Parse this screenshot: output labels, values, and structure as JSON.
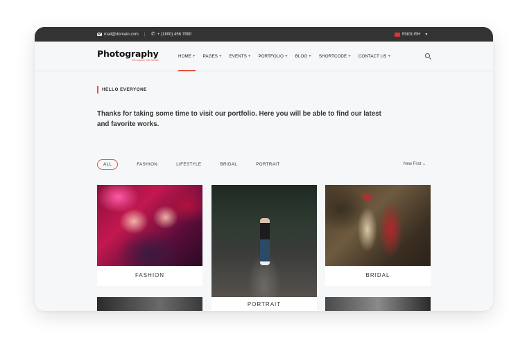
{
  "topbar": {
    "email": "mail@domain.com",
    "separator": "|",
    "phone": "+ (1800) 456 7890",
    "language": "ENGLISH"
  },
  "header": {
    "logo_title": "Photography",
    "logo_tagline": "We Capture Your Smiles",
    "nav": [
      {
        "label": "HOME",
        "suffix": "+",
        "active": true
      },
      {
        "label": "PAGES",
        "suffix": "+"
      },
      {
        "label": "EVENTS",
        "suffix": "+"
      },
      {
        "label": "PORTFOLIO",
        "suffix": "+"
      },
      {
        "label": "BLOG",
        "suffix": "+"
      },
      {
        "label": "SHORTCODE",
        "suffix": "+"
      },
      {
        "label": "CONTACT US",
        "suffix": "+"
      }
    ]
  },
  "intro": {
    "eyebrow": "HELLO EVERYONE",
    "text": "Thanks for taking some time to visit our portfolio. Here you will be able to find our latest and favorite works."
  },
  "filters": {
    "items": [
      "ALL",
      "FASHION",
      "LIFESTYLE",
      "BRIDAL",
      "PORTRAIT"
    ],
    "active": "ALL",
    "sort_label": "New First"
  },
  "gallery": [
    {
      "label": "FASHION"
    },
    {
      "label": "PORTRAIT"
    },
    {
      "label": "BRIDAL"
    }
  ],
  "colors": {
    "accent": "#e8533a",
    "topbar_bg": "#333333",
    "page_bg": "#f6f7f9"
  }
}
